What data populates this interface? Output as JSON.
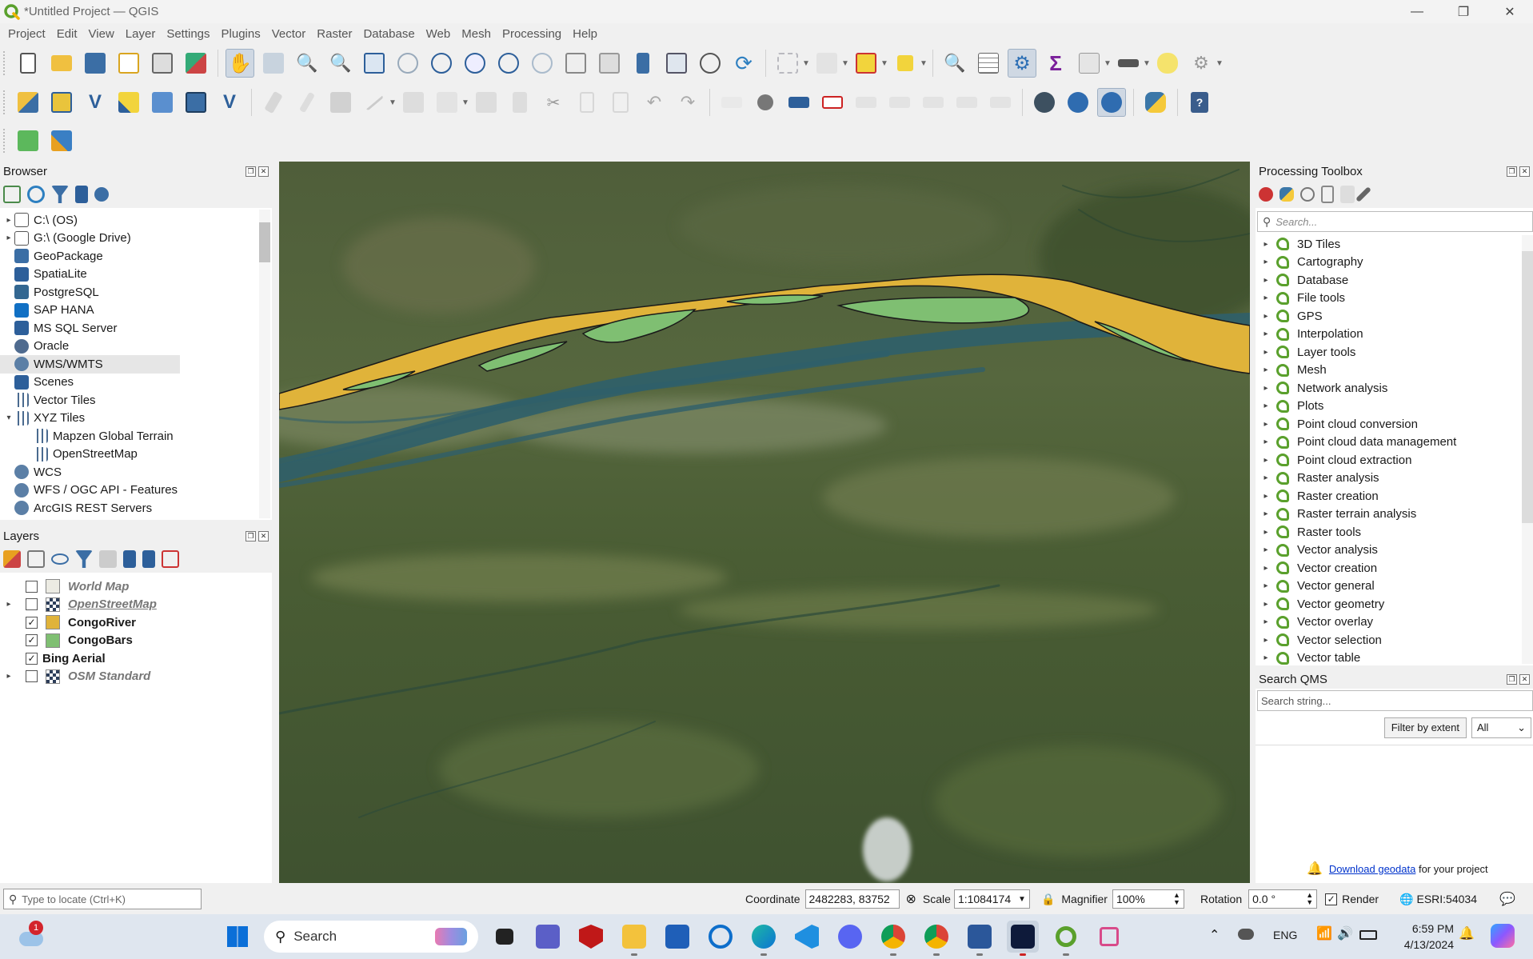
{
  "window": {
    "title": "*Untitled Project — QGIS",
    "controls": [
      "—",
      "❐",
      "✕"
    ]
  },
  "menubar": [
    "Project",
    "Edit",
    "View",
    "Layer",
    "Settings",
    "Plugins",
    "Vector",
    "Raster",
    "Database",
    "Web",
    "Mesh",
    "Processing",
    "Help"
  ],
  "browser": {
    "title": "Browser",
    "items": [
      {
        "label": "C:\\ (OS)",
        "icon": "folder-icon",
        "expandable": true
      },
      {
        "label": "G:\\ (Google Drive)",
        "icon": "folder-icon",
        "expandable": true
      },
      {
        "label": "GeoPackage",
        "icon": "geopackage-icon",
        "expandable": false
      },
      {
        "label": "SpatiaLite",
        "icon": "spatialite-icon",
        "expandable": false
      },
      {
        "label": "PostgreSQL",
        "icon": "postgresql-icon",
        "expandable": false
      },
      {
        "label": "SAP HANA",
        "icon": "sap-hana-icon",
        "expandable": false
      },
      {
        "label": "MS SQL Server",
        "icon": "mssql-icon",
        "expandable": false
      },
      {
        "label": "Oracle",
        "icon": "oracle-icon",
        "expandable": false
      },
      {
        "label": "WMS/WMTS",
        "icon": "globe-icon",
        "expandable": false
      },
      {
        "label": "Scenes",
        "icon": "scenes-icon",
        "expandable": false
      },
      {
        "label": "Vector Tiles",
        "icon": "grid-icon",
        "expandable": false
      },
      {
        "label": "XYZ Tiles",
        "icon": "grid-icon",
        "expandable": true
      },
      {
        "label": "Mapzen Global Terrain",
        "icon": "grid-icon",
        "expandable": false
      },
      {
        "label": "OpenStreetMap",
        "icon": "grid-icon",
        "expandable": false
      },
      {
        "label": "WCS",
        "icon": "globe-icon",
        "expandable": false
      },
      {
        "label": "WFS / OGC API - Features",
        "icon": "globe-icon",
        "expandable": false
      },
      {
        "label": "ArcGIS REST Servers",
        "icon": "globe-icon",
        "expandable": false
      }
    ]
  },
  "layers": {
    "title": "Layers",
    "items": [
      {
        "label": "World Map",
        "checked": false,
        "color": "#ecebe3"
      },
      {
        "label": "OpenStreetMap",
        "checked": false,
        "color": "checker"
      },
      {
        "label": "CongoRiver",
        "checked": true,
        "color": "#e0b33a"
      },
      {
        "label": "CongoBars",
        "checked": true,
        "color": "#7fbf72"
      },
      {
        "label": "Bing Aerial",
        "checked": true,
        "color": ""
      },
      {
        "label": "OSM Standard",
        "checked": false,
        "color": "checker"
      }
    ]
  },
  "processing": {
    "title": "Processing Toolbox",
    "search_placeholder": "Search...",
    "items": [
      "3D Tiles",
      "Cartography",
      "Database",
      "File tools",
      "GPS",
      "Interpolation",
      "Layer tools",
      "Mesh",
      "Network analysis",
      "Plots",
      "Point cloud conversion",
      "Point cloud data management",
      "Point cloud extraction",
      "Raster analysis",
      "Raster creation",
      "Raster terrain analysis",
      "Raster tools",
      "Vector analysis",
      "Vector creation",
      "Vector general",
      "Vector geometry",
      "Vector overlay",
      "Vector selection",
      "Vector table"
    ]
  },
  "qms": {
    "title": "Search QMS",
    "search_placeholder": "Search string...",
    "filter_button": "Filter by extent",
    "filter_select": "All",
    "download_link": "Download geodata",
    "download_suffix": " for your project"
  },
  "statusbar": {
    "locate_placeholder": "Type to locate (Ctrl+K)",
    "coordinate_label": "Coordinate",
    "coordinate_value": "2482283, 83752",
    "scale_label": "Scale",
    "scale_value": "1:1084174",
    "magnifier_label": "Magnifier",
    "magnifier_value": "100%",
    "rotation_label": "Rotation",
    "rotation_value": "0.0 °",
    "render_label": "Render",
    "crs": "ESRI:54034"
  },
  "taskbar": {
    "search_label": "Search",
    "notification_count": "1",
    "lang": "ENG",
    "time": "6:59 PM",
    "date": "4/13/2024"
  },
  "colors": {
    "river": "#e0b33a",
    "bars": "#7fbf72",
    "water": "#2f5f6a"
  }
}
